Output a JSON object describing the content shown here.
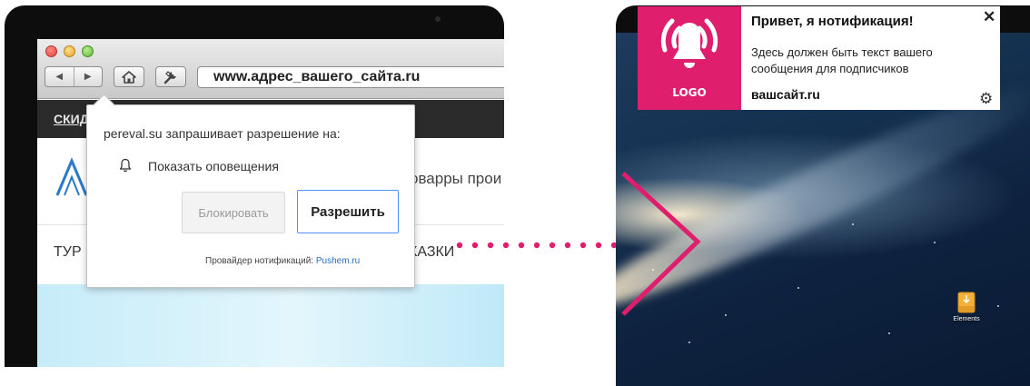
{
  "browser": {
    "url": "www.адрес_вашего_сайта.ru",
    "back_symbol": "◀",
    "forward_symbol": "▶",
    "icons": [
      "home-icon",
      "tools-icon",
      "close-traffic-light",
      "minimize-traffic-light",
      "zoom-traffic-light"
    ]
  },
  "website": {
    "nav_link": "СКИД",
    "tagline": "оварры прои",
    "menu_left": "ТУР",
    "menu_right": "КАЗКИ"
  },
  "permission_prompt": {
    "title": "pereval.su запрашивает разрешение на:",
    "item": "Показать оповещения",
    "block_label": "Блокировать",
    "allow_label": "Разрешить",
    "provider_prefix": "Провайдер нотификаций:",
    "provider_link": "Pushem.ru",
    "icon": "bell-icon"
  },
  "notification": {
    "logo_text": "LOGO",
    "title": "Привет, я нотификация!",
    "body": "Здесь должен быть текст вашего сообщения для подписчиков",
    "site": "вашсайт.ru",
    "close_symbol": "✕",
    "gear_symbol": "⚙",
    "icons": [
      "bell-icon",
      "close-icon",
      "gear-icon"
    ]
  },
  "desktop": {
    "icon_label": "Elements"
  },
  "colors": {
    "accent": "#e01e6e",
    "button_focus": "#4d90fe",
    "link": "#2a6ebb"
  }
}
